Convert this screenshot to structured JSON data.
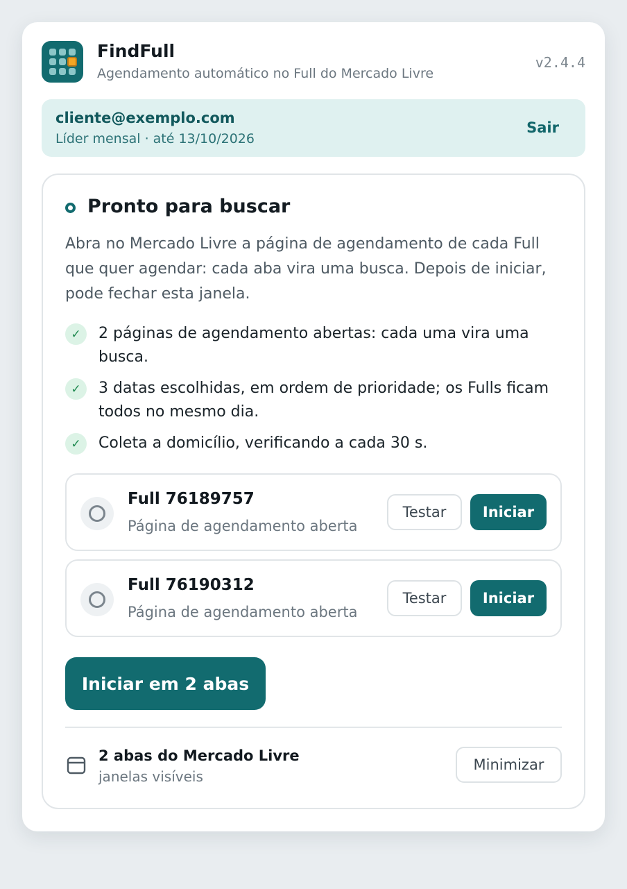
{
  "app": {
    "title": "FindFull",
    "subtitle": "Agendamento automático no Full do Mercado Livre",
    "version": "v2.4.4"
  },
  "account": {
    "email": "cliente@exemplo.com",
    "plan": "Líder mensal · até 13/10/2026",
    "logout_label": "Sair"
  },
  "status": {
    "title": "Pronto para buscar",
    "intro": "Abra no Mercado Livre a página de agendamento de cada Full que quer agendar: cada aba vira uma busca. Depois de iniciar, pode fechar esta janela."
  },
  "checks": [
    {
      "text": "2 páginas de agendamento abertas: cada uma vira uma busca.",
      "icon": "check-icon"
    },
    {
      "text": "3 datas escolhidas, em ordem de prioridade; os Fulls ficam todos no mesmo dia.",
      "icon": "check-icon"
    },
    {
      "text": "Coleta a domicílio, verificando a cada 30 s.",
      "icon": "check-icon"
    }
  ],
  "fulls": [
    {
      "name": "Full 76189757",
      "status": "Página de agendamento aberta",
      "test_label": "Testar",
      "start_label": "Iniciar"
    },
    {
      "name": "Full 76190312",
      "status": "Página de agendamento aberta",
      "test_label": "Testar",
      "start_label": "Iniciar"
    }
  ],
  "start_all_label": "Iniciar em 2 abas",
  "tabs_info": {
    "title": "2 abas do Mercado Livre",
    "subtitle": "janelas visíveis",
    "minimize_label": "Minimizar",
    "icon": "window-icon"
  },
  "colors": {
    "accent": "#126b6f",
    "account_bg": "#dff1f0",
    "check_bg": "#dcf3e6",
    "check_fg": "#1f8a50",
    "logo_highlight": "#f4a623"
  }
}
